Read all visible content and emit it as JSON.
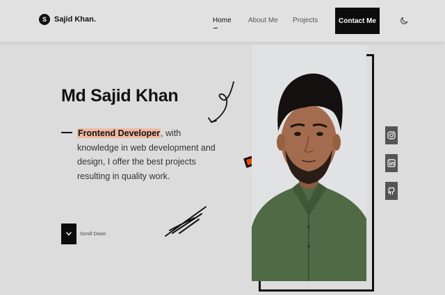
{
  "brand": {
    "badge": "S",
    "name": "Sajid Khan."
  },
  "nav": {
    "links": [
      {
        "label": "Home",
        "active": true
      },
      {
        "label": "About Me",
        "active": false
      },
      {
        "label": "Projects",
        "active": false
      }
    ],
    "contact_label": "Contact Me",
    "theme_icon": "moon-icon"
  },
  "hero": {
    "name": "Md Sajid Khan",
    "role": "Frontend Developer",
    "description": ", with knowledge in web development and design, I offer the best projects resulting in quality work.",
    "scroll_label": "Scroll Down"
  },
  "social": [
    {
      "icon": "instagram-icon"
    },
    {
      "icon": "linkedin-icon"
    },
    {
      "icon": "github-icon"
    }
  ],
  "colors": {
    "background": "#dcdcdc",
    "accent": "#e8480e",
    "highlight": "#f0b8a0",
    "dark": "#0c0c0c"
  }
}
